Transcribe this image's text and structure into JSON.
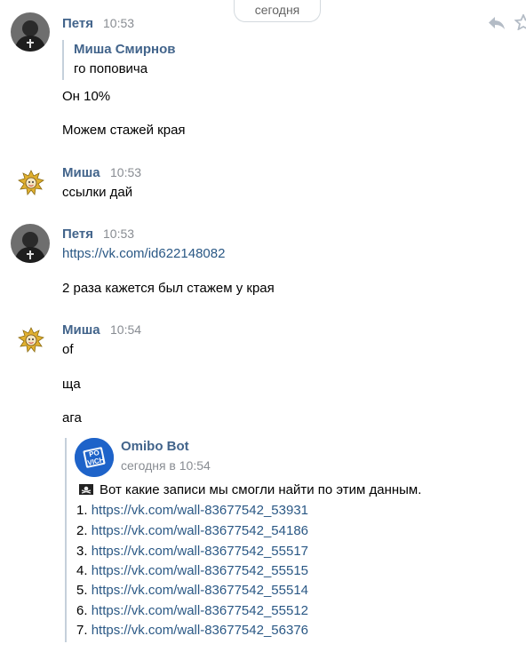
{
  "date_label": "сегодня",
  "messages": [
    {
      "author": "Петя",
      "time": "10:53",
      "quote": {
        "author": "Миша Смирнов",
        "text": "го поповича"
      },
      "lines": [
        "Он 10%",
        "Можем стажей края"
      ]
    },
    {
      "author": "Миша",
      "time": "10:53",
      "lines": [
        "ссылки дай"
      ]
    },
    {
      "author": "Петя",
      "time": "10:53",
      "link": "https://vk.com/id622148082",
      "lines": [
        "2 раза кажется был стажем у края"
      ]
    },
    {
      "author": "Миша",
      "time": "10:54",
      "lines": [
        "of",
        "ща",
        "ага"
      ],
      "forwarded": {
        "author": "Omibo Bot",
        "time": "сегодня в 10:54",
        "avatar_text": "PO VICH",
        "text": "Вот какие записи мы смогли найти по этим данным.",
        "links": [
          {
            "num": "1.",
            "url": "https://vk.com/wall-83677542_53931"
          },
          {
            "num": "2.",
            "url": "https://vk.com/wall-83677542_54186"
          },
          {
            "num": "3.",
            "url": "https://vk.com/wall-83677542_55517"
          },
          {
            "num": "4.",
            "url": "https://vk.com/wall-83677542_55515"
          },
          {
            "num": "5.",
            "url": "https://vk.com/wall-83677542_55514"
          },
          {
            "num": "6.",
            "url": "https://vk.com/wall-83677542_55512"
          },
          {
            "num": "7.",
            "url": "https://vk.com/wall-83677542_56376"
          }
        ]
      }
    }
  ],
  "colors": {
    "name": "#42648b",
    "link": "#2a5885",
    "time": "#888c92",
    "quote_bar": "#c5d0db",
    "bot_avatar": "#1e63c9"
  },
  "icons": [
    "reply-icon",
    "star-icon",
    "pirate-flag-icon"
  ]
}
